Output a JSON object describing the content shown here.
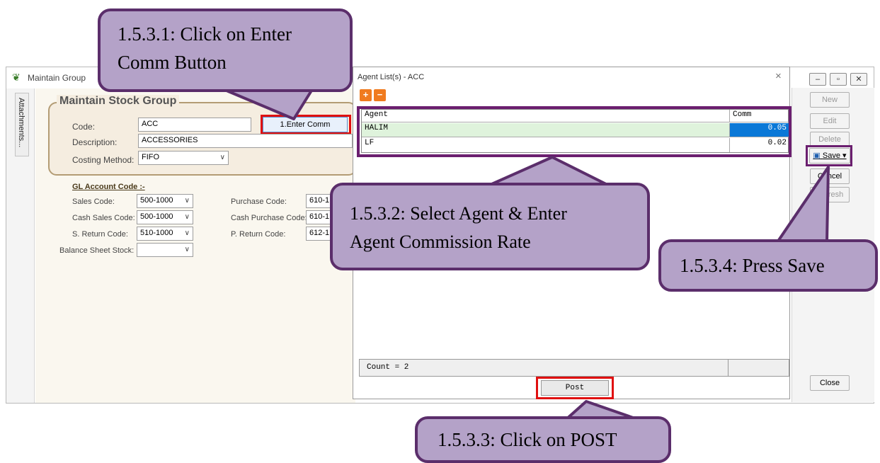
{
  "main_window": {
    "title": "Maintain Group",
    "controls": [
      "–",
      "▫",
      "✕"
    ],
    "attachments_tab": "Attachments..."
  },
  "form": {
    "header_title": "Maintain Stock Group",
    "code_label": "Code:",
    "code_value": "ACC",
    "description_label": "Description:",
    "description_value": "ACCESSORIES",
    "costing_label": "Costing Method:",
    "costing_value": "FIFO",
    "enter_comm_label": "1.Enter Comm",
    "gl_title": "GL Account Code :-",
    "sales_code_label": "Sales Code:",
    "sales_code_value": "500-1000",
    "cash_sales_label": "Cash Sales Code:",
    "cash_sales_value": "500-1000",
    "s_return_label": "S. Return Code:",
    "s_return_value": "510-1000",
    "balance_label": "Balance Sheet Stock:",
    "balance_value": "",
    "purchase_label": "Purchase Code:",
    "purchase_value": "610-1",
    "cash_purchase_label": "Cash Purchase Code:",
    "cash_purchase_value": "610-1",
    "p_return_label": "P. Return Code:",
    "p_return_value": "612-1"
  },
  "buttons": {
    "new": "New",
    "edit": "Edit",
    "delete": "Delete",
    "save": "Save",
    "cancel": "Cancel",
    "refresh": "Refresh",
    "close": "Close"
  },
  "dialog": {
    "title": "Agent List(s) - ACC",
    "close": "×",
    "add_symbol": "+",
    "remove_symbol": "−",
    "columns": [
      "Agent",
      "Comm"
    ],
    "rows": [
      {
        "agent": "HALIM",
        "comm": "0.05"
      },
      {
        "agent": "LF",
        "comm": "0.02"
      }
    ],
    "count_text": "Count = 2",
    "post_label": "Post"
  },
  "callouts": {
    "c1_line1": "1.5.3.1: Click on Enter",
    "c1_line2": "Comm Button",
    "c2_line1": "1.5.3.2: Select Agent & Enter",
    "c2_line2": "Agent Commission Rate",
    "c3": "1.5.3.3: Click on POST",
    "c4": "1.5.3.4: Press Save"
  },
  "colors": {
    "callout_fill": "#b4a2c8",
    "callout_border": "#5b2e6b",
    "highlight_red": "#e01010",
    "highlight_purple": "#6b1f6f",
    "selected_cell": "#0a78d7",
    "selected_row": "#dff3dc"
  }
}
